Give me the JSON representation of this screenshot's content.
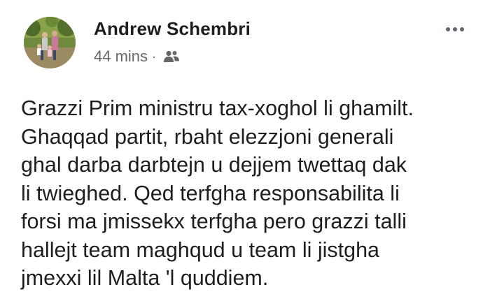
{
  "post": {
    "author_name": "Andrew Schembri",
    "timestamp": "44 mins",
    "separator": "·",
    "audience_icon": "friends-icon",
    "more_icon": "more-options-icon",
    "body_lines": [
      "Grazzi Prim ministru tax-xoghol li ghamilt.",
      "Ghaqqad partit, rbaht elezzjoni generali",
      "ghal darba darbtejn u dejjem twettaq dak",
      "li twieghed. Qed terfgha responsabilita li",
      "forsi ma jmissekx terfgha pero grazzi talli",
      "hallejt team maghqud u team li jistgha",
      "jmexxi lil Malta 'l quddiem."
    ]
  },
  "colors": {
    "text_primary": "#1c1e21",
    "text_secondary": "#65676b",
    "background": "#ffffff"
  }
}
